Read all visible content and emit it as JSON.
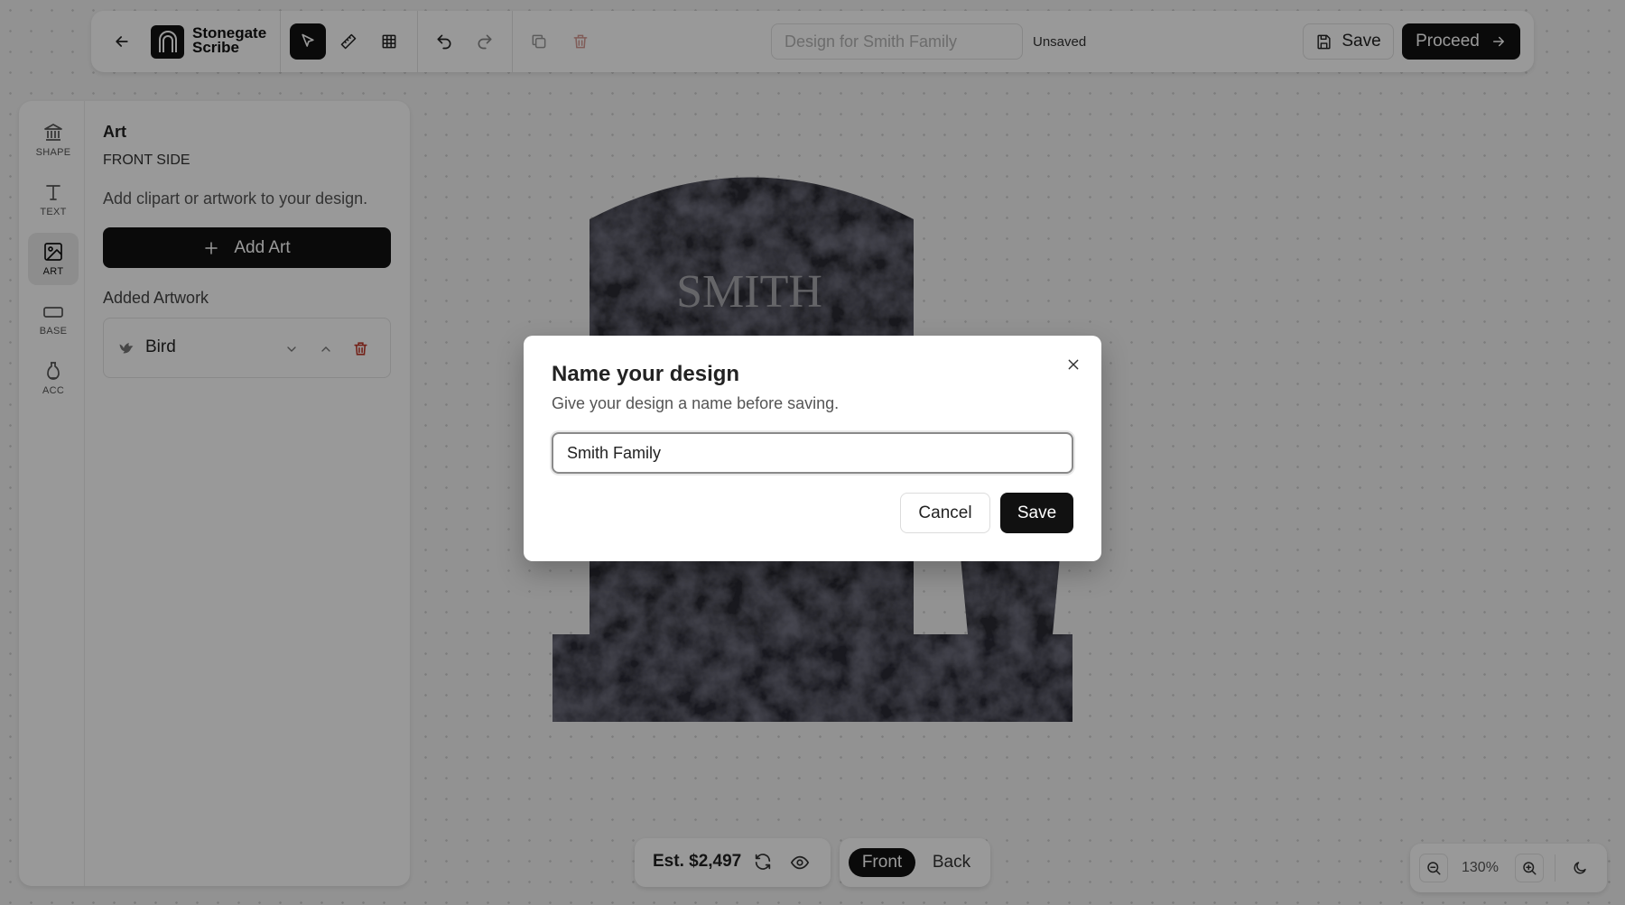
{
  "app": {
    "brand_line1": "Stonegate",
    "brand_line2": "Scribe"
  },
  "toolbar": {
    "title_placeholder": "Design for Smith Family",
    "status": "Unsaved",
    "save_label": "Save",
    "proceed_label": "Proceed",
    "tools": [
      "select-tool",
      "ruler-tool",
      "grid-tool"
    ],
    "icons": [
      "arrow-left-icon",
      "cursor-icon",
      "ruler-icon",
      "grid-icon",
      "undo-icon",
      "redo-icon",
      "duplicate-icon",
      "trash-icon",
      "save-icon",
      "arrow-right-icon"
    ],
    "accent_color": "#111111",
    "danger_color": "#c0392b"
  },
  "rail": {
    "items": [
      {
        "label": "SHAPE",
        "icon": "monument-shape-icon"
      },
      {
        "label": "TEXT",
        "icon": "text-icon"
      },
      {
        "label": "ART",
        "icon": "image-icon",
        "active": true
      },
      {
        "label": "BASE",
        "icon": "base-icon"
      },
      {
        "label": "ACC",
        "icon": "vase-icon"
      }
    ]
  },
  "panel": {
    "title": "Art",
    "subtitle": "FRONT SIDE",
    "description": "Add clipart or artwork to your design.",
    "add_button": "Add Art",
    "added_title": "Added Artwork",
    "artwork": [
      {
        "name": "Bird",
        "icon": "bird-icon"
      }
    ]
  },
  "canvas": {
    "inscription": "SMITH",
    "stone_color": "#2a2a33"
  },
  "bottom": {
    "estimate": "Est. $2,497",
    "front_label": "Front",
    "back_label": "Back",
    "zoom": "130%"
  },
  "dialog": {
    "title": "Name your design",
    "description": "Give your design a name before saving.",
    "input_value": "Smith Family",
    "cancel_label": "Cancel",
    "save_label": "Save"
  }
}
